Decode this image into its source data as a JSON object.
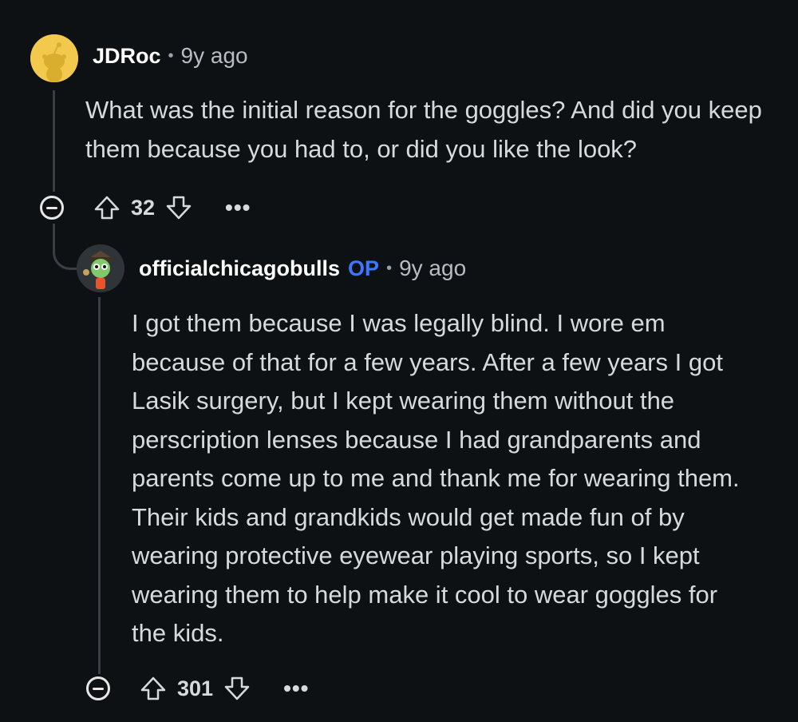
{
  "comments": [
    {
      "author": "JDRoc",
      "separator": "•",
      "time": "9y ago",
      "body": "What was the initial reason for the goggles? And did you keep them because you had to, or did you like the look?",
      "score": "32",
      "more_label": "•••",
      "avatar_color": "#f2c94c"
    },
    {
      "author": "officialchicagobulls",
      "op_badge": "OP",
      "separator": "•",
      "time": "9y ago",
      "body": "I got them because I was legally blind. I wore em because of that for a few years. After a few years I got Lasik surgery, but I kept wearing them without the perscription lenses because I had grandparents and parents come up to me and thank me for wearing them. Their kids and grandkids would get made fun of by wearing protective eyewear playing sports, so I kept wearing them to help make it cool to wear goggles for the kids.",
      "score": "301",
      "more_label": "•••",
      "op_color": "#3c78ff"
    }
  ],
  "icons": {
    "collapse": "collapse-icon",
    "upvote": "upvote-icon",
    "downvote": "downvote-icon",
    "more": "more-options-icon"
  }
}
